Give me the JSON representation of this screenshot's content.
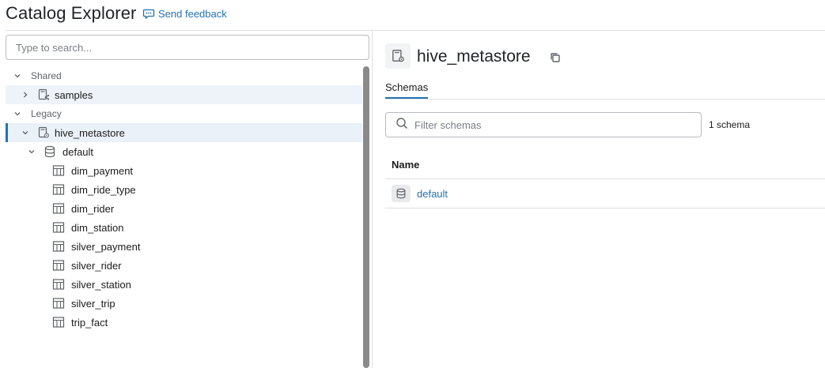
{
  "header": {
    "title": "Catalog Explorer",
    "feedback_label": "Send feedback"
  },
  "sidebar": {
    "search_placeholder": "Type to search...",
    "sections": {
      "shared": "Shared",
      "legacy": "Legacy"
    },
    "catalogs": {
      "samples": "samples",
      "hive_metastore": "hive_metastore"
    },
    "schema": "default",
    "tables": [
      "dim_payment",
      "dim_ride_type",
      "dim_rider",
      "dim_station",
      "silver_payment",
      "silver_rider",
      "silver_station",
      "silver_trip",
      "trip_fact"
    ]
  },
  "detail": {
    "title": "hive_metastore",
    "tab_label": "Schemas",
    "filter_placeholder": "Filter schemas",
    "count_label": "1 schema",
    "column_header": "Name",
    "rows": [
      {
        "name": "default"
      }
    ]
  },
  "colors": {
    "accent": "#2272b4",
    "selected_bg": "#eaf1f8",
    "hover_bg": "#eef3f9"
  }
}
